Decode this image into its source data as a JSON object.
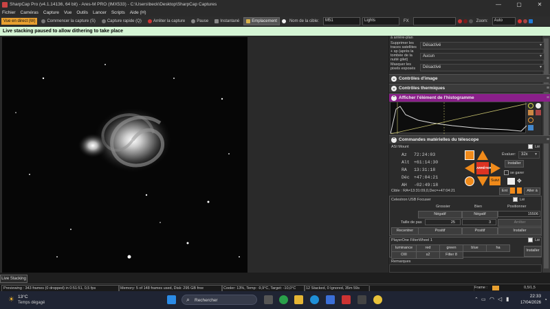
{
  "window": {
    "title": "SharpCap Pro (v4.1.14136, 64 bit) - Ares-M PRO (IMX533) - C:\\Users\\beck\\Desktop\\SharpCap Captures",
    "minimize": "—",
    "maximize": "▢",
    "close": "✕"
  },
  "menu": [
    "Fichier",
    "Caméras",
    "Capture",
    "Vue",
    "Outils",
    "Lancer",
    "Scripts",
    "Aide (H)"
  ],
  "toolbar": {
    "live_view": "Vue en direct (W)",
    "start_capture": "Commencer la capture (S)",
    "quick_capture": "Capture rapide (Q)",
    "stop_capture": "Arrêter la capture",
    "pause": "Pause",
    "snapshot": "Instantané",
    "location": "Emplacement",
    "target_label": "Nom de la cible:",
    "target_value": "M51",
    "frame_type": "Lights",
    "fx_label": "FX",
    "zoom_label": "Zoom:",
    "zoom_value": "Auto"
  },
  "notice": "Live stacking paused to allow dithering to take place",
  "panel": {
    "partial_row": "à arrière-plan",
    "satellite_label": "Supprimer les traces satellites + sp (après la tombée de la nuité gilet)",
    "satellite_value": "Désactivé",
    "aucun_value": "Aucun",
    "mask_label": "Masquer les pixels exposés",
    "mask_value": "Désactivé",
    "section_image": "Contrôles d'image",
    "section_thermal": "Contrôles thermiques",
    "section_histogram": "Afficher l'élément de l'histogramme",
    "section_telescope": "Commandes matérielles du télescope",
    "mount": {
      "name": "ASI Mount",
      "linked": "Lié",
      "az_label": "Az",
      "az": "72:24:03",
      "alt_label": "Alt",
      "alt": "+61:14:30",
      "ra_label": "RA",
      "ra": "13:31:18",
      "dec_label": "Déc",
      "dec": "+47:04:21",
      "ah_label": "AH",
      "ah": "-02:49:18",
      "evaluate_label": "Évaluer:",
      "evaluate_value": "32x",
      "install": "Installer",
      "park": "se garer",
      "stop": "ARRÊTER",
      "follow": "Suivi",
      "target": "Cible : RA=13:31:09,0,Dec=+47:04:21",
      "go_label": "Ent",
      "goto": "Aller à"
    },
    "focuser": {
      "name": "Celestron USB Focuser",
      "linked": "Lié",
      "col_coarse": "Grossier",
      "col_fine": "Bien",
      "col_position": "Positionner",
      "neg1": "Négatif",
      "neg2": "Négatif",
      "position": "15506",
      "step_label": "Taille de pas",
      "step1": "25",
      "step2": "3",
      "stop": "Arrêter",
      "recenter": "Recentrer",
      "pos1": "Positif",
      "pos2": "Positif",
      "install": "Installer"
    },
    "filterwheel": {
      "name": "PlayerOne FilterWheel 1",
      "linked": "Lié",
      "filters": [
        "luminance",
        "red",
        "green",
        "blue",
        "ha",
        "OIII",
        "s2",
        "Filter 8"
      ],
      "install": "Installer"
    },
    "remarks": "Remarques"
  },
  "live_stacking_tab": "Live Stacking",
  "status": {
    "preview": "Previewing : 343 frames (0 dropped) in 0:51:51, 0,5 fps",
    "memory": "Memory: 5 of 148 frames used, Disk: 295 GB free",
    "cooler": "Cooler: 13%, Temp: -9,9°C, Target: -10,0°C",
    "stacked": "12 Stacked, 0 Ignored, 35m 59s",
    "frame_label": "Frame :",
    "frame_value": "0,5/1,5"
  },
  "taskbar": {
    "temp": "13°C",
    "weather": "Temps dégagé",
    "search": "Rechercher",
    "time": "22:33",
    "date": "17/04/2026"
  },
  "colors": {
    "accent": "#e8a030",
    "notice_bg": "#d5f5d5",
    "histogram_header": "#8a1f8a",
    "arrow": "#f08a1a"
  }
}
